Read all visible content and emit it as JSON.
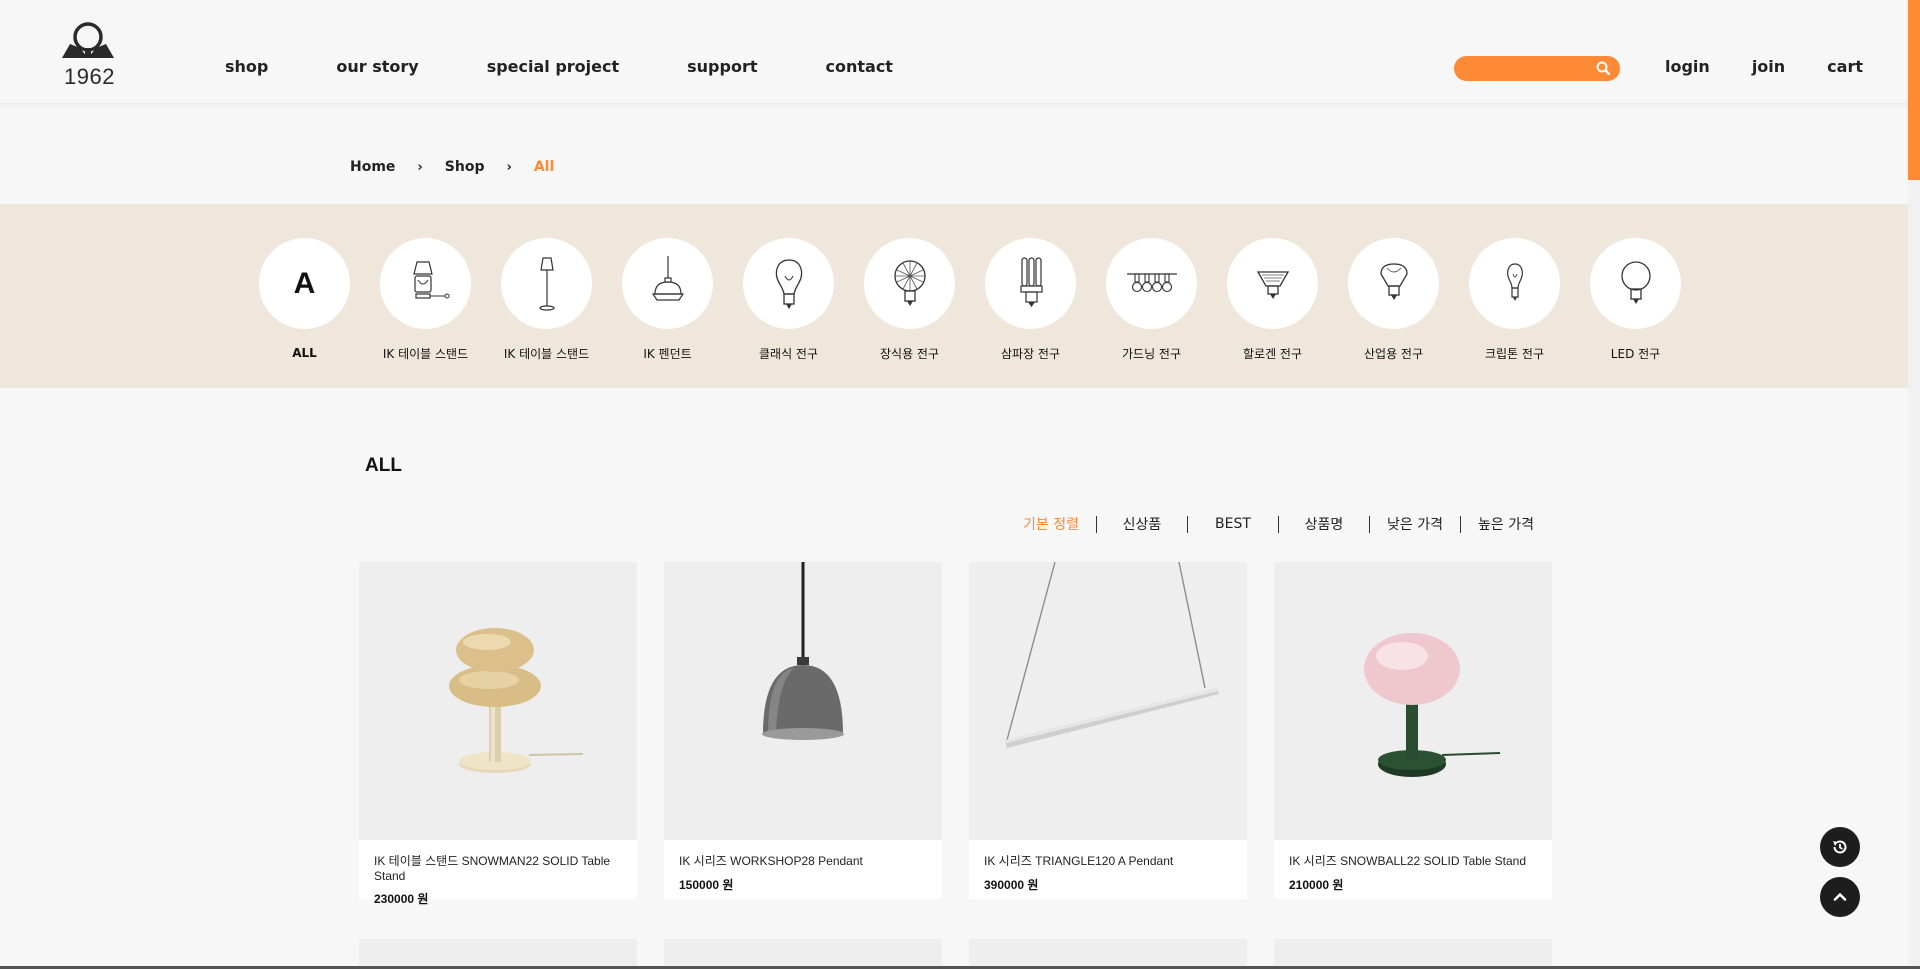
{
  "brand": {
    "logo_text": "1962"
  },
  "nav": [
    "shop",
    "our story",
    "special project",
    "support",
    "contact"
  ],
  "search": {
    "placeholder": ""
  },
  "user_links": [
    "login",
    "join",
    "cart"
  ],
  "breadcrumb": {
    "home": "Home",
    "shop": "Shop",
    "current": "All"
  },
  "categories": [
    {
      "label": "ALL",
      "letter": "A",
      "icon": "all-letter"
    },
    {
      "label": "IK 테이블 스탠드",
      "icon": "table-lamp-icon"
    },
    {
      "label": "IK 테이블 스탠드",
      "icon": "floor-lamp-icon"
    },
    {
      "label": "IK 펜던트",
      "icon": "pendant-icon"
    },
    {
      "label": "클래식 전구",
      "icon": "classic-bulb-icon"
    },
    {
      "label": "장식용 전구",
      "icon": "decorative-bulb-icon"
    },
    {
      "label": "삼파장 전구",
      "icon": "tri-band-bulb-icon"
    },
    {
      "label": "가드닝 전구",
      "icon": "string-light-icon"
    },
    {
      "label": "할로겐 전구",
      "icon": "halogen-bulb-icon"
    },
    {
      "label": "산업용 전구",
      "icon": "industrial-bulb-icon"
    },
    {
      "label": "크립톤 전구",
      "icon": "krypton-bulb-icon"
    },
    {
      "label": "LED 전구",
      "icon": "led-bulb-icon"
    }
  ],
  "section": {
    "title": "ALL"
  },
  "sort_options": [
    "기본 정렬",
    "신상품",
    "BEST",
    "상품명",
    "낮은 가격",
    "높은 가격"
  ],
  "products": [
    {
      "name": "IK 테이블 스탠드 SNOWMAN22 SOLID Table Stand",
      "price": "230000 원"
    },
    {
      "name": "IK 시리즈 WORKSHOP28 Pendant",
      "price": "150000 원"
    },
    {
      "name": "IK 시리즈 TRIANGLE120 A Pendant",
      "price": "390000 원"
    },
    {
      "name": "IK 시리즈 SNOWBALL22 SOLID Table Stand",
      "price": "210000 원"
    }
  ],
  "colors": {
    "accent": "#fe8a35",
    "band": "#efe7db",
    "background": "#f7f7f7",
    "fab": "#1d1d1d"
  }
}
